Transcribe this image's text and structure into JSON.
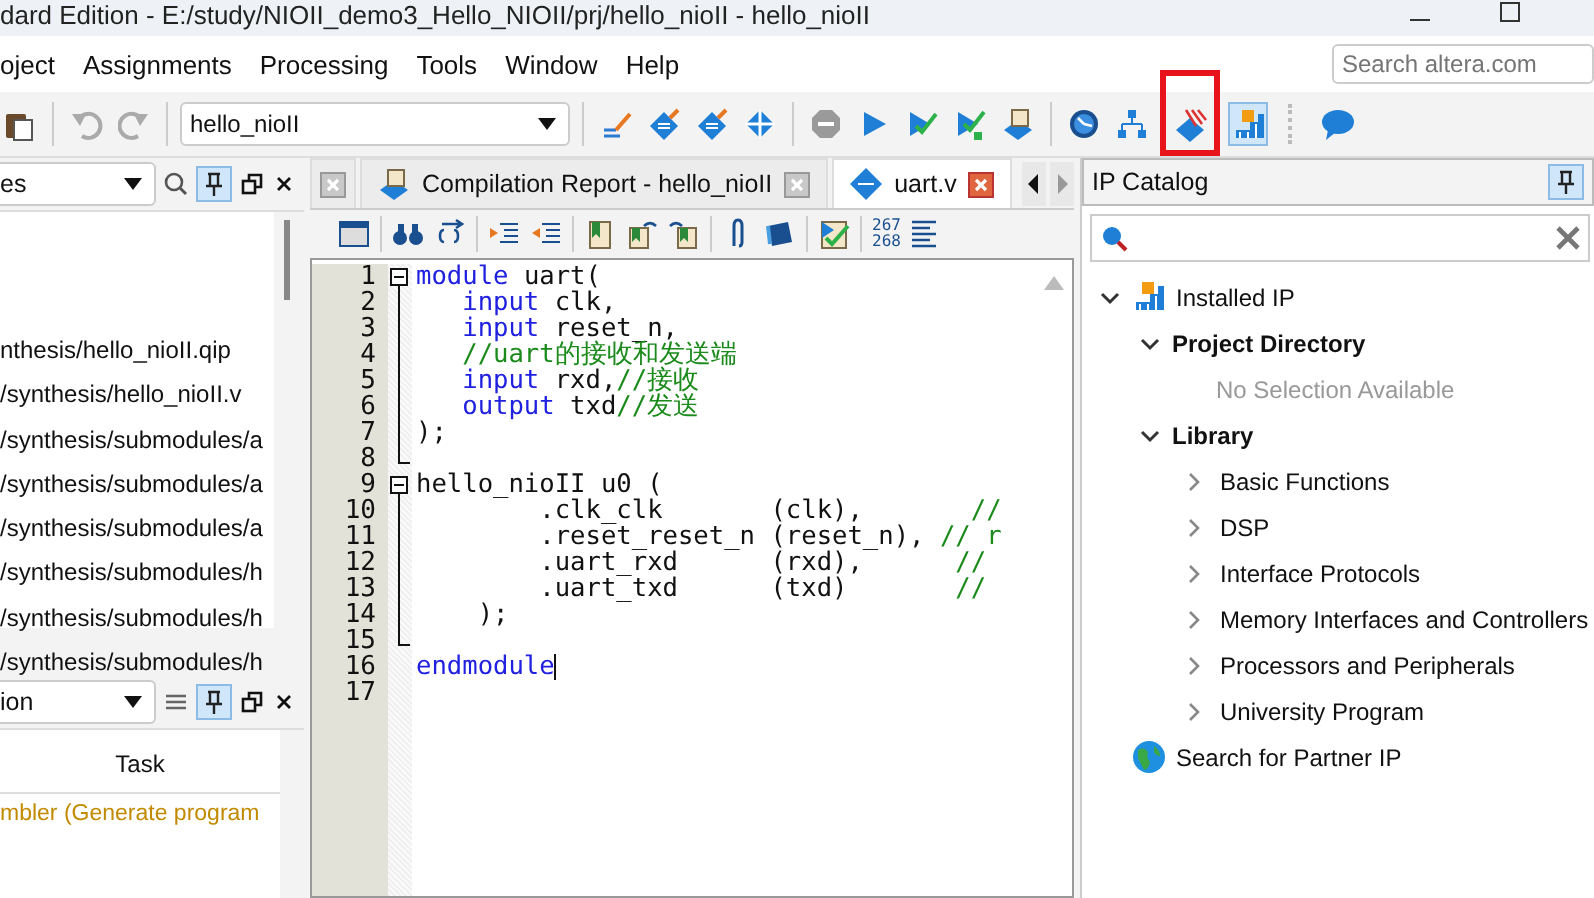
{
  "window": {
    "title": "dard Edition - E:/study/NIOII_demo3_Hello_NIOII/prj/hello_nioII - hello_nioII"
  },
  "menu": [
    "oject",
    "Assignments",
    "Processing",
    "Tools",
    "Window",
    "Help"
  ],
  "search": {
    "placeholder": "Search altera.com"
  },
  "toolbar": {
    "revision": "hello_nioII",
    "ip_catalog_pressed": true,
    "highlight_on_platform_designer": true
  },
  "project_navigator": {
    "view": "es",
    "pinned": true,
    "files": [
      "nthesis/hello_nioII.qip",
      "/synthesis/hello_nioII.v",
      "/synthesis/submodules/a",
      "/synthesis/submodules/a",
      "/synthesis/submodules/a",
      "/synthesis/submodules/h",
      "/synthesis/submodules/h",
      "/synthesis/submodules/h"
    ]
  },
  "tasks_panel": {
    "view": "ion",
    "pinned": true,
    "column": "Task",
    "rows": [
      "mbler (Generate program"
    ]
  },
  "editor": {
    "tabs": [
      {
        "selected": false
      },
      {
        "label": "Compilation Report - hello_nioII",
        "selected": false
      },
      {
        "label": "uart.v",
        "selected": true
      }
    ],
    "goto_line_label": [
      "267",
      "268"
    ],
    "lines": [
      {
        "number": "1",
        "kind": "fold_start",
        "segments": [
          {
            "kind": "keyword",
            "text": "module"
          },
          {
            "kind": "plain",
            "text": " uart("
          }
        ]
      },
      {
        "number": "2",
        "kind": "fold_mid",
        "segments": [
          {
            "kind": "keyword",
            "text": "   input"
          },
          {
            "kind": "plain",
            "text": " clk,"
          }
        ]
      },
      {
        "number": "3",
        "kind": "fold_mid",
        "segments": [
          {
            "kind": "keyword",
            "text": "   input"
          },
          {
            "kind": "plain",
            "text": " reset_n,"
          }
        ]
      },
      {
        "number": "4",
        "kind": "fold_mid",
        "segments": [
          {
            "kind": "comment",
            "text": "   //uart的接收和发送端"
          }
        ]
      },
      {
        "number": "5",
        "kind": "fold_mid",
        "segments": [
          {
            "kind": "keyword",
            "text": "   input"
          },
          {
            "kind": "plain",
            "text": " rxd,"
          },
          {
            "kind": "comment",
            "text": "//接收"
          }
        ]
      },
      {
        "number": "6",
        "kind": "fold_mid",
        "segments": [
          {
            "kind": "keyword",
            "text": "   output"
          },
          {
            "kind": "plain",
            "text": " txd"
          },
          {
            "kind": "comment",
            "text": "//发送"
          }
        ]
      },
      {
        "number": "7",
        "kind": "fold_mid",
        "segments": [
          {
            "kind": "plain",
            "text": ");"
          }
        ]
      },
      {
        "number": "8",
        "kind": "fold_end"
      },
      {
        "number": "9",
        "kind": "fold_start",
        "segments": [
          {
            "kind": "plain",
            "text": "hello_nioII u0 ("
          }
        ]
      },
      {
        "number": "10",
        "kind": "fold_mid",
        "segments": [
          {
            "kind": "plain",
            "text": "        .clk_clk       (clk),       "
          },
          {
            "kind": "comment",
            "text": "//"
          }
        ]
      },
      {
        "number": "11",
        "kind": "fold_mid",
        "segments": [
          {
            "kind": "plain",
            "text": "        .reset_reset_n (reset_n), "
          },
          {
            "kind": "comment",
            "text": "// r"
          }
        ]
      },
      {
        "number": "12",
        "kind": "fold_mid",
        "segments": [
          {
            "kind": "plain",
            "text": "        .uart_rxd      (rxd),      "
          },
          {
            "kind": "comment",
            "text": "//"
          }
        ]
      },
      {
        "number": "13",
        "kind": "fold_mid",
        "segments": [
          {
            "kind": "plain",
            "text": "        .uart_txd      (txd)       "
          },
          {
            "kind": "comment",
            "text": "//"
          }
        ]
      },
      {
        "number": "14",
        "kind": "fold_mid",
        "segments": [
          {
            "kind": "plain",
            "text": "    );"
          }
        ]
      },
      {
        "number": "15",
        "kind": "fold_end"
      },
      {
        "number": "16",
        "kind": "plain",
        "cursor": true,
        "segments": [
          {
            "kind": "keyword",
            "text": "endmodule"
          }
        ]
      },
      {
        "number": "17",
        "kind": "plain"
      }
    ]
  },
  "ip_catalog": {
    "title": "IP Catalog",
    "pinned": true,
    "tree": [
      {
        "label": "Installed IP",
        "kind": "root",
        "expanded": true,
        "children": [
          {
            "label": "Project Directory",
            "kind": "group",
            "expanded": true,
            "children": [
              {
                "label": "No Selection Available",
                "kind": "note"
              }
            ]
          },
          {
            "label": "Library",
            "kind": "group",
            "expanded": true,
            "children": [
              {
                "label": "Basic Functions",
                "kind": "leaf",
                "expanded": false
              },
              {
                "label": "DSP",
                "kind": "leaf",
                "expanded": false
              },
              {
                "label": "Interface Protocols",
                "kind": "leaf",
                "expanded": false
              },
              {
                "label": "Memory Interfaces and Controllers",
                "kind": "leaf",
                "expanded": false
              },
              {
                "label": "Processors and Peripherals",
                "kind": "leaf",
                "expanded": false
              },
              {
                "label": "University Program",
                "kind": "leaf",
                "expanded": false
              }
            ]
          }
        ]
      },
      {
        "label": "Search for Partner IP",
        "kind": "link"
      }
    ]
  }
}
